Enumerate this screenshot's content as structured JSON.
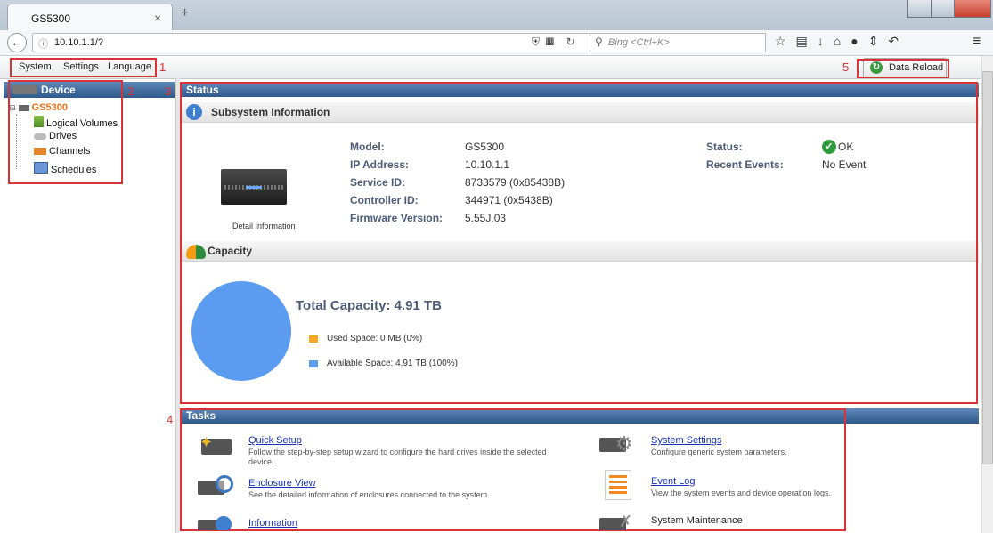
{
  "browser": {
    "tab_title": "GS5300",
    "tab_close": "×",
    "new_tab": "+",
    "url": "10.10.1.1/?",
    "search_placeholder": "Bing <Ctrl+K>"
  },
  "menu": {
    "items": [
      "System",
      "Settings",
      "Language"
    ]
  },
  "reload": {
    "label": "Data Reload"
  },
  "markers": [
    "1",
    "2",
    "3",
    "4",
    "5"
  ],
  "sidebar": {
    "header": "Device",
    "root": "GS5300",
    "items": [
      "Logical Volumes",
      "Drives",
      "Channels",
      "Schedules"
    ]
  },
  "status": {
    "header": "Status",
    "subsystem": {
      "title": "Subsystem Information",
      "detail_link": "Detail Information",
      "fields": [
        {
          "label": "Model:",
          "value": "GS5300"
        },
        {
          "label": "IP Address:",
          "value": "10.10.1.1"
        },
        {
          "label": "Service ID:",
          "value": "8733579 (0x85438B)"
        },
        {
          "label": "Controller ID:",
          "value": "344971 (0x5438B)"
        },
        {
          "label": "Firmware Version:",
          "value": "5.55J.03"
        }
      ],
      "status_label": "Status:",
      "status_value": "OK",
      "events_label": "Recent Events:",
      "events_value": "No Event"
    },
    "capacity": {
      "title": "Capacity",
      "total": "Total Capacity: 4.91 TB",
      "used": "Used Space: 0 MB (0%)",
      "available": "Available Space: 4.91 TB (100%)",
      "used_fraction": 0,
      "used_color": "#f5a623",
      "available_color": "#5b9cf0"
    }
  },
  "tasks": {
    "header": "Tasks",
    "items": [
      {
        "title": "Quick Setup",
        "desc": "Follow the step-by-step setup wizard to configure the hard drives inside the selected device."
      },
      {
        "title": "Enclosure View",
        "desc": "See the detailed information of enclosures connected to the system."
      },
      {
        "title": "Information",
        "desc": ""
      },
      {
        "title": "System Settings",
        "desc": "Configure generic system parameters."
      },
      {
        "title": "Event Log",
        "desc": "View the system events and device operation logs."
      },
      {
        "title": "System Maintenance",
        "desc": ""
      }
    ]
  }
}
